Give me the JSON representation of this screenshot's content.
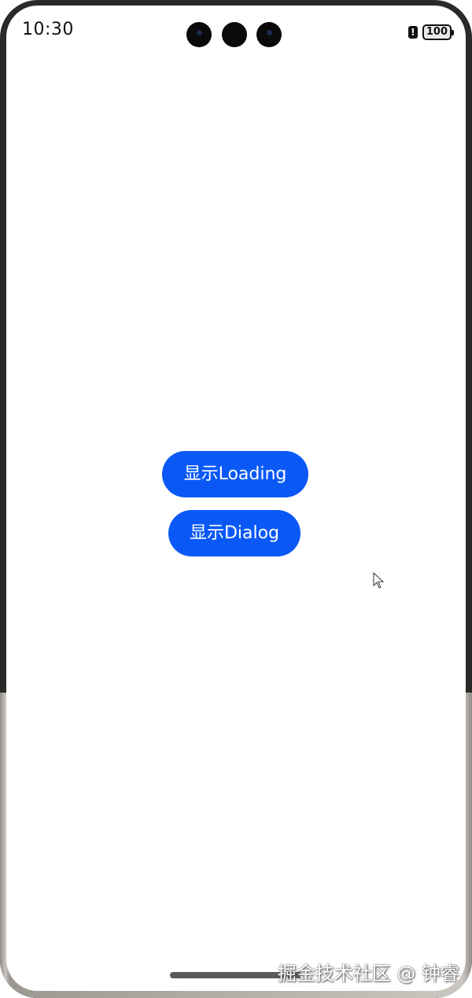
{
  "status_bar": {
    "time": "10:30",
    "alert_symbol": "!",
    "battery_level": "100"
  },
  "buttons": {
    "show_loading": "显示Loading",
    "show_dialog": "显示Dialog"
  },
  "colors": {
    "button_bg": "#0a59f7",
    "button_text": "#ffffff",
    "screen_bg": "#ffffff"
  },
  "icons": [
    "camera-icon",
    "alert-icon",
    "battery-icon",
    "cursor-icon"
  ],
  "watermark": "掘金技术社区 @ 钟睿"
}
